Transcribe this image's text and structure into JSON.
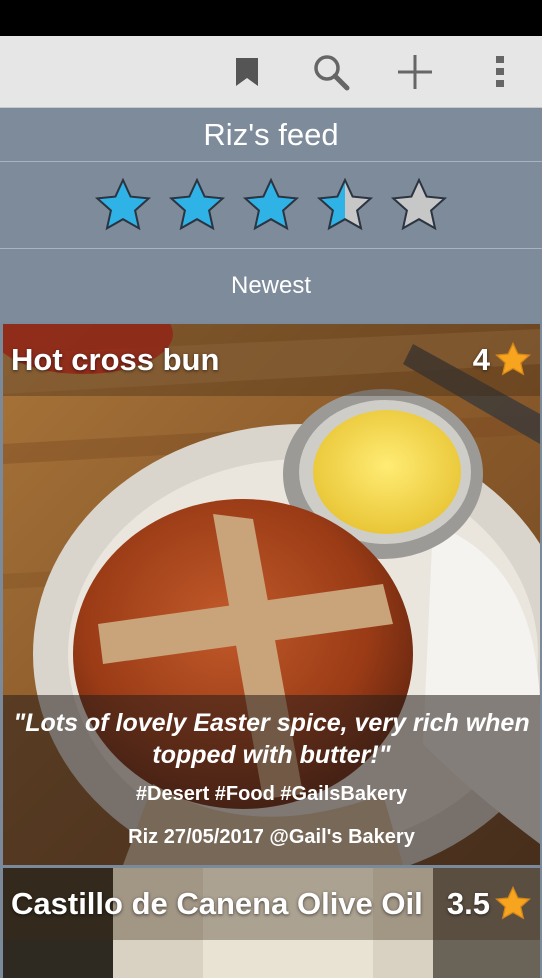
{
  "toolbar": {
    "bookmark_icon": "bookmark-icon",
    "search_icon": "search-icon",
    "add_icon": "add-icon",
    "overflow_icon": "overflow-menu-icon"
  },
  "feed": {
    "title": "Riz's feed",
    "rating": 3.5,
    "rating_max": 5,
    "sort_label": "Newest"
  },
  "colors": {
    "star_fill": "#2fb2e6",
    "star_empty": "#c7c7c7",
    "header_bg": "#7d8b9b",
    "card_star": "#f7a41e"
  },
  "cards": [
    {
      "title": "Hot cross bun",
      "score": "4",
      "quote": "\"Lots of lovely Easter spice, very rich when topped with butter!\"",
      "tags": "#Desert #Food #GailsBakery",
      "meta": "Riz 27/05/2017 @Gail's Bakery"
    },
    {
      "title": "Castillo de Canena Olive Oil",
      "score": "3.5"
    }
  ]
}
